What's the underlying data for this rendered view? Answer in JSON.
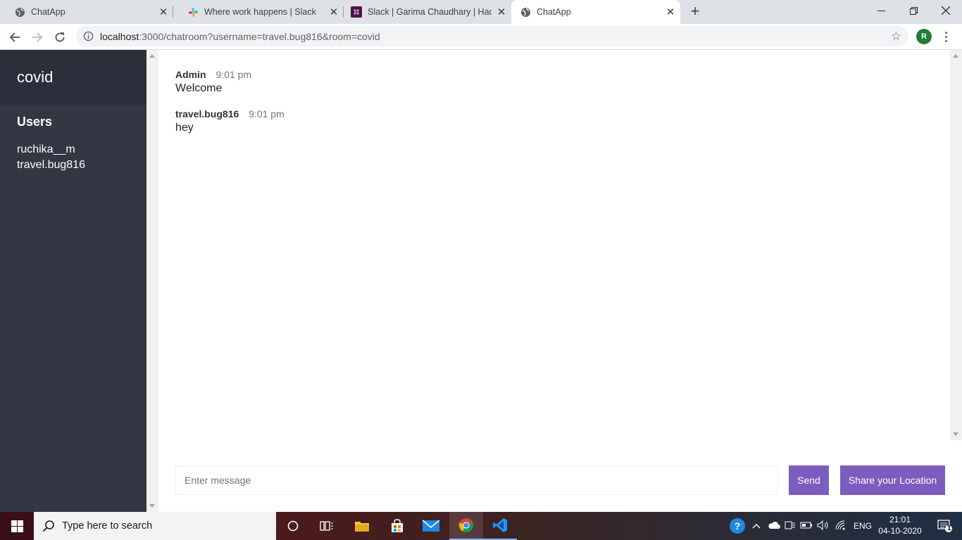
{
  "browser": {
    "tabs": [
      {
        "title": "ChatApp",
        "icon": "globe-icon"
      },
      {
        "title": "Where work happens | Slack",
        "icon": "slack-icon"
      },
      {
        "title": "Slack | Garima Chaudhary | Hacka",
        "icon": "slack-workspace-icon"
      },
      {
        "title": "ChatApp",
        "icon": "globe-icon",
        "active": true
      }
    ],
    "new_tab": "+",
    "url_host": "localhost",
    "url_path": ":3000/chatroom?username=travel.bug816&room=covid",
    "profile_initial": "R"
  },
  "sidebar": {
    "room_name": "covid",
    "users_title": "Users",
    "users": [
      "ruchika__m",
      "travel.bug816"
    ]
  },
  "messages": [
    {
      "username": "Admin",
      "time": "9:01 pm",
      "text": "Welcome"
    },
    {
      "username": "travel.bug816",
      "time": "9:01 pm",
      "text": "hey"
    }
  ],
  "composer": {
    "placeholder": "Enter message",
    "send_label": "Send",
    "location_label": "Share your Location"
  },
  "taskbar": {
    "search_placeholder": "Type here to search",
    "language": "ENG",
    "time": "21:01",
    "date": "04-10-2020",
    "notification_count": "1"
  },
  "colors": {
    "sidebar_bg": "#333744",
    "sidebar_header_bg": "#2c2f3b",
    "button_bg": "#7c5cbf"
  }
}
